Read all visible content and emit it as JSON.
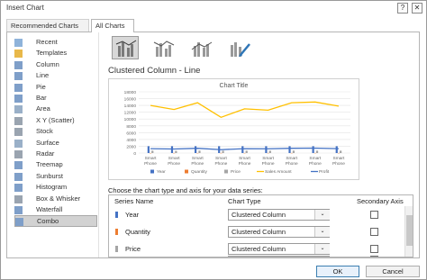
{
  "window": {
    "title": "Insert Chart",
    "help_label": "?",
    "close_label": "✕"
  },
  "tabs": [
    {
      "label": "Recommended Charts"
    },
    {
      "label": "All Charts"
    }
  ],
  "sidebar": {
    "items": [
      {
        "label": "Recent",
        "icon": "recent-icon"
      },
      {
        "label": "Templates",
        "icon": "folder-icon"
      },
      {
        "label": "Column",
        "icon": "column-chart-icon"
      },
      {
        "label": "Line",
        "icon": "line-chart-icon"
      },
      {
        "label": "Pie",
        "icon": "pie-chart-icon"
      },
      {
        "label": "Bar",
        "icon": "bar-chart-icon"
      },
      {
        "label": "Area",
        "icon": "area-chart-icon"
      },
      {
        "label": "X Y (Scatter)",
        "icon": "scatter-chart-icon"
      },
      {
        "label": "Stock",
        "icon": "stock-chart-icon"
      },
      {
        "label": "Surface",
        "icon": "surface-chart-icon"
      },
      {
        "label": "Radar",
        "icon": "radar-chart-icon"
      },
      {
        "label": "Treemap",
        "icon": "treemap-chart-icon"
      },
      {
        "label": "Sunburst",
        "icon": "sunburst-chart-icon"
      },
      {
        "label": "Histogram",
        "icon": "histogram-chart-icon"
      },
      {
        "label": "Box & Whisker",
        "icon": "box-whisker-chart-icon"
      },
      {
        "label": "Waterfall",
        "icon": "waterfall-chart-icon"
      },
      {
        "label": "Combo",
        "icon": "combo-chart-icon"
      }
    ],
    "selected": "Combo"
  },
  "main": {
    "type_title": "Clustered Column - Line",
    "lower_label": "Choose the chart type and axis for your data series:",
    "headers": {
      "series": "Series Name",
      "type": "Chart Type",
      "axis": "Secondary Axis"
    },
    "rows": [
      {
        "name": "Year",
        "type": "Clustered Column",
        "color": "#4472c4"
      },
      {
        "name": "Quantity",
        "type": "Clustered Column",
        "color": "#ed7d31"
      },
      {
        "name": "Price",
        "type": "Clustered Column",
        "color": "#a5a5a5"
      }
    ],
    "partial_row_color": "#ffc000",
    "dropdown_arrow": "⌄"
  },
  "chart_data": {
    "type": "bar",
    "title": "Chart Title",
    "categories": [
      "Smart Phone",
      "Smart Phone",
      "Smart Phone",
      "Smart Phone",
      "Smart Phone",
      "Smart Phone",
      "Smart Phone",
      "Smart Phone",
      "Smart Phone"
    ],
    "ylim": [
      0,
      18000
    ],
    "yticks": [
      "0",
      "2000",
      "4000",
      "6000",
      "8000",
      "10000",
      "12000",
      "14000",
      "16000",
      "18000"
    ],
    "series": [
      {
        "name": "Year",
        "kind": "bar",
        "color": "#4472c4",
        "values": [
          2016,
          2016,
          2016,
          2016,
          2016,
          2017,
          2017,
          2017,
          2017
        ]
      },
      {
        "name": "Quantity",
        "kind": "bar",
        "color": "#ed7d31",
        "values": [
          20,
          25,
          18,
          30,
          22,
          28,
          26,
          30,
          24
        ]
      },
      {
        "name": "Price",
        "kind": "bar",
        "color": "#a5a5a5",
        "values": [
          700,
          650,
          720,
          680,
          700,
          690,
          710,
          700,
          690
        ]
      },
      {
        "name": "Sales Amount",
        "kind": "line",
        "color": "#ffc000",
        "values": [
          14000,
          12800,
          14800,
          10500,
          13000,
          12600,
          14800,
          15000,
          13800
        ]
      },
      {
        "name": "Profit",
        "kind": "line",
        "color": "#4472c4",
        "values": [
          1300,
          1200,
          1400,
          1000,
          1300,
          1250,
          1400,
          1450,
          1300
        ]
      }
    ],
    "grid": true,
    "legend": "bottom"
  },
  "footer": {
    "ok": "OK",
    "cancel": "Cancel"
  }
}
